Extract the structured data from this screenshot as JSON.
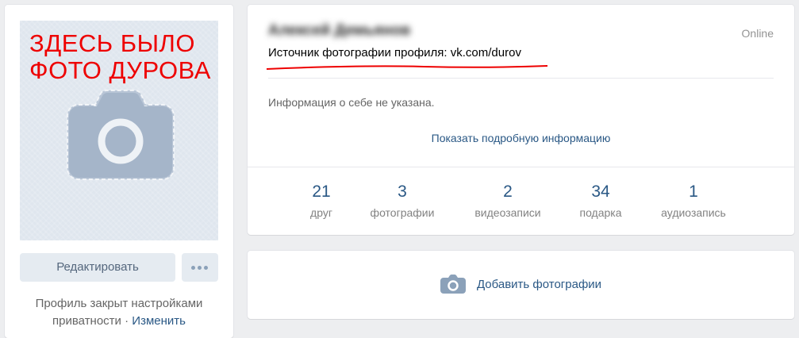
{
  "left_column": {
    "overlay_text": "ЗДЕСЬ БЫЛО\nФОТО ДУРОВА",
    "edit_button": "Редактировать",
    "privacy_text": "Профиль закрыт настройками приватности",
    "privacy_separator": " · ",
    "privacy_link": "Изменить"
  },
  "profile": {
    "name": "Алексей Демьянов",
    "status": "Online",
    "source_text": "Источник фотографии профиля: vk.com/durov",
    "about": "Информация о себе не указана.",
    "show_more": "Показать подробную информацию",
    "counters": [
      {
        "value": "21",
        "label": "друг"
      },
      {
        "value": "3",
        "label": "фотографии"
      },
      {
        "value": "2",
        "label": "видеозаписи"
      },
      {
        "value": "34",
        "label": "подарка"
      },
      {
        "value": "1",
        "label": "аудиозапись"
      }
    ]
  },
  "photos_block": {
    "add_label": "Добавить фотографии"
  },
  "colors": {
    "accent": "#2a5885",
    "annotation_red": "#ee0000",
    "background": "#edeef0"
  },
  "icons": {
    "avatar_placeholder": "camera-icon",
    "add_photo": "camera-icon",
    "more": "more-dots-icon"
  }
}
